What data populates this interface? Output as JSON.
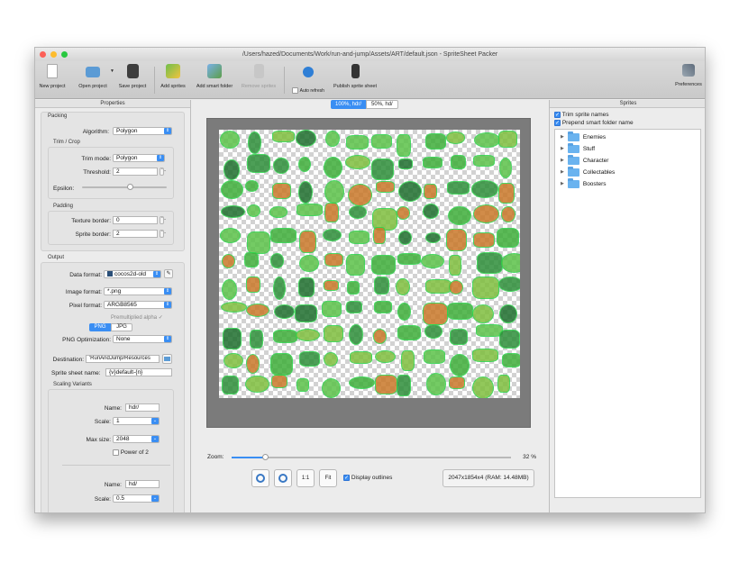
{
  "window": {
    "title": "/Users/hazed/Documents/Work/run-and-jump/Assets/ART/default.json - SpriteSheet Packer"
  },
  "toolbar": {
    "new_project": "New project",
    "open_project": "Open project",
    "save_project": "Save project",
    "add_sprites": "Add sprites",
    "add_smart_folder": "Add smart folder",
    "remove_sprites": "Remove sprites",
    "auto_refresh": "Auto refresh",
    "publish": "Publish sprite sheet",
    "preferences": "Preferences"
  },
  "properties": {
    "header": "Properties",
    "packing": {
      "title": "Packing",
      "algorithm_label": "Algorithm:",
      "algorithm": "Polygon"
    },
    "trim": {
      "title": "Trim / Crop",
      "mode_label": "Trim mode:",
      "mode": "Polygon",
      "threshold_label": "Threshold:",
      "threshold": "2",
      "epsilon_label": "Epsilon:",
      "epsilon_fraction": 0.56
    },
    "padding": {
      "title": "Padding",
      "texture_border_label": "Texture border:",
      "texture_border": "0",
      "sprite_border_label": "Sprite border:",
      "sprite_border": "2"
    },
    "output": {
      "title": "Output",
      "data_format_label": "Data format:",
      "data_format": "cocos2d-old",
      "image_format_label": "Image format:",
      "image_format": "*.png",
      "pixel_format_label": "Pixel format:",
      "pixel_format": "ARGB8565",
      "premultiplied": "Premultiplied alpha",
      "png_tab": "PNG",
      "jpg_tab": "JPG",
      "png_opt_label": "PNG Optimization:",
      "png_opt": "None",
      "destination_label": "Destination:",
      "destination": "'RunAndJump/Resources",
      "sheet_name_label": "Sprite sheet name:",
      "sheet_name": "{v}default-{n}"
    },
    "scaling": {
      "title": "Scaling Variants",
      "v1": {
        "name_label": "Name:",
        "name": "hdr/",
        "scale_label": "Scale:",
        "scale": "1",
        "maxsize_label": "Max size:",
        "maxsize": "2048",
        "power2": "Power of 2"
      },
      "v2": {
        "name_label": "Name:",
        "name": "hd/",
        "scale_label": "Scale:",
        "scale": "0.5"
      }
    }
  },
  "preview": {
    "tabs": [
      "100%, hdr/",
      "50%, hd/"
    ],
    "zoom_label": "Zoom:",
    "zoom_value": "32 %",
    "zoom_fraction": 0.12,
    "zoom_out": "zoom-out",
    "zoom_in": "zoom-in",
    "one_to_one": "1:1",
    "fit": "Fit",
    "display_outlines": "Display outlines",
    "info": "2047x1854x4 (RAM: 14.48MB)"
  },
  "sprites": {
    "header": "Sprites",
    "trim_names": "Trim sprite names",
    "prepend_smart": "Prepend smart folder name",
    "folders": [
      "Enemies",
      "Stuff",
      "Character",
      "Collectables",
      "Boosters"
    ]
  },
  "colors": {
    "accent": "#3a8ef3",
    "sprite_green": "#3fae3a",
    "sprite_orange": "#c9782a"
  }
}
